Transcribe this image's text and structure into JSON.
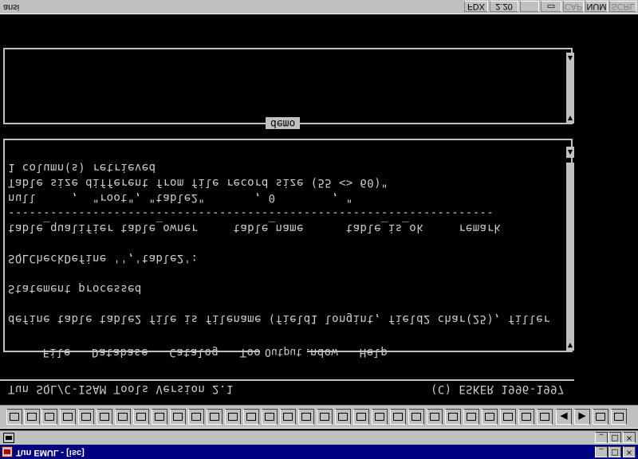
{
  "window": {
    "title": "Tun EMUL - [isc]",
    "min": "_",
    "max": "□",
    "close": "×"
  },
  "menu_bar": {
    "items": [
      "File",
      "Database",
      "Catalog",
      "Tools",
      "Window",
      "Help"
    ]
  },
  "header": {
    "product": "Tun SQL/C-ISAM Tools Version 2.1",
    "copyright": "(C) ESKER 1996-1997"
  },
  "output_panel": {
    "title": "Output",
    "lines": [
      "define table table2 file is filename (field1 longint, field2 char(25), filler",
      "",
      "Statement processed",
      "",
      "SQLCheckDefine '','table2':",
      "",
      "table_qualifier table_owner     table_name      table_is_ok     remark",
      "---------------------------------------------------------------------",
      "null     ,  \"root\", \"table2\"       , 0        , \"",
      "Table size different from file record size (55 <> 60)\"",
      "1 column(s) retrieved"
    ]
  },
  "demo_panel": {
    "title": "demo"
  },
  "status_bar": {
    "terminal": "ansi",
    "mode": "FDX",
    "version": "2.20",
    "caps": "CAP",
    "num": "NUM",
    "scroll": "SCRL"
  },
  "toolbar": {
    "buttons": [
      "connect",
      "disconnect",
      "open-session",
      "save-session",
      "save",
      "copy",
      "paste",
      "print",
      "keyboard",
      "function-keys",
      "color",
      "macro",
      "debug",
      "search",
      "settings",
      "transfer",
      "capture",
      "screen",
      "record",
      "play",
      "stop",
      "send-file",
      "receive-file",
      "hotspot-1",
      "hotspot-2",
      "hotspot-3",
      "hotspot-4",
      "hotspot-5",
      "hotspot-6",
      "hotspot-7",
      "previous",
      "next",
      "tile",
      "cascade"
    ]
  }
}
